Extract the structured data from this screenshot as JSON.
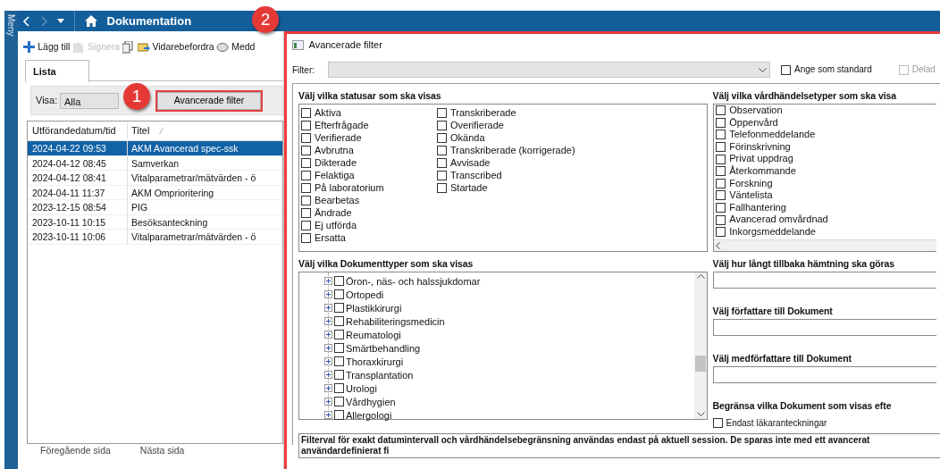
{
  "side_menu": {
    "label": "Meny"
  },
  "header": {
    "title": "Dokumentation"
  },
  "toolbar": [
    {
      "label": "Lägg till",
      "disabled": false
    },
    {
      "label": "Signera",
      "disabled": true
    },
    {
      "disabled": false
    },
    {
      "label": "Vidarebefordra",
      "disabled": false
    },
    {
      "label": "Medd",
      "disabled": false
    }
  ],
  "tabs": [
    {
      "label": "Lista",
      "selected": true
    }
  ],
  "view_filter": {
    "label": "Visa:",
    "value": "Alla",
    "button": "Avancerade filter"
  },
  "table": {
    "columns": [
      "Utförandedatum/tid",
      "Titel"
    ],
    "rows": [
      {
        "cells": [
          "2024-04-22 09:53",
          "AKM Avancerad spec-ssk"
        ],
        "selected": true
      },
      {
        "cells": [
          "2024-04-12 08:45",
          "Samverkan"
        ],
        "selected": false
      },
      {
        "cells": [
          "2024-04-12 08:41",
          "Vitalparametrar/mätvärden - ö"
        ],
        "selected": false
      },
      {
        "cells": [
          "2024-04-11 11:37",
          "AKM Omprioritering"
        ],
        "selected": false
      },
      {
        "cells": [
          "2023-12-15 08:54",
          "PIG"
        ],
        "selected": false
      },
      {
        "cells": [
          "2023-10-11 10:15",
          "Besöksanteckning"
        ],
        "selected": false
      },
      {
        "cells": [
          "2023-10-11 10:06",
          "Vitalparametrar/mätvärden - ö"
        ],
        "selected": false
      }
    ]
  },
  "pager": [
    "Föregående sida",
    "Nästa sida"
  ],
  "callouts": [
    "1",
    "2"
  ],
  "dialog": {
    "title": "Avancerade filter",
    "filter_label": "Filter:",
    "set_default": {
      "label": "Ange som standard",
      "checked": false,
      "disabled": false
    },
    "shared": {
      "label": "Delad",
      "checked": false,
      "disabled": true
    },
    "statuses": {
      "heading": "Välj vilka statusar som ska visas",
      "items": [
        {
          "label": "Aktiva",
          "checked": false
        },
        {
          "label": "Efterfrågade",
          "checked": false
        },
        {
          "label": "Verifierade",
          "checked": false
        },
        {
          "label": "Avbrutna",
          "checked": false
        },
        {
          "label": "Dikterade",
          "checked": false
        },
        {
          "label": "Felaktiga",
          "checked": false
        },
        {
          "label": "På laboratorium",
          "checked": false
        },
        {
          "label": "Bearbetas",
          "checked": false
        },
        {
          "label": "Ändrade",
          "checked": false
        },
        {
          "label": "Ej utförda",
          "checked": false
        },
        {
          "label": "Ersatta",
          "checked": false
        },
        {
          "label": "Transkriberade",
          "checked": false
        },
        {
          "label": "Overifierade",
          "checked": false
        },
        {
          "label": "Okända",
          "checked": false
        },
        {
          "label": "Transkriberade (korrigerade)",
          "checked": false
        },
        {
          "label": "Avvisade",
          "checked": false
        },
        {
          "label": "Transcribed",
          "checked": false
        },
        {
          "label": "Startade",
          "checked": false
        }
      ]
    },
    "care_event_types": {
      "heading": "Välj vilka vårdhändelsetyper som ska visa",
      "items": [
        {
          "label": "Observation",
          "checked": false
        },
        {
          "label": "Öppenvård",
          "checked": false
        },
        {
          "label": "Telefonmeddelande",
          "checked": false
        },
        {
          "label": "Förinskrivning",
          "checked": false
        },
        {
          "label": "Privat uppdrag",
          "checked": false
        },
        {
          "label": "Återkommande",
          "checked": false
        },
        {
          "label": "Forskning",
          "checked": false
        },
        {
          "label": "Väntelista",
          "checked": false
        },
        {
          "label": "Fallhantering",
          "checked": false
        },
        {
          "label": "Avancerad omvårdnad",
          "checked": false
        },
        {
          "label": "Inkorgsmeddelande",
          "checked": false
        }
      ]
    },
    "document_types": {
      "heading": "Välj vilka Dokumenttyper som ska visas",
      "items": [
        {
          "label": "Öron-, näs- och halssjukdomar",
          "checked": false,
          "expanded": false
        },
        {
          "label": "Ortopedi",
          "checked": false,
          "expanded": false
        },
        {
          "label": "Plastikkirurgi",
          "checked": false,
          "expanded": false
        },
        {
          "label": "Rehabiliteringsmedicin",
          "checked": false,
          "expanded": false
        },
        {
          "label": "Reumatologi",
          "checked": false,
          "expanded": false
        },
        {
          "label": "Smärtbehandling",
          "checked": false,
          "expanded": false
        },
        {
          "label": "Thoraxkirurgi",
          "checked": false,
          "expanded": false
        },
        {
          "label": "Transplantation",
          "checked": false,
          "expanded": false
        },
        {
          "label": "Urologi",
          "checked": false,
          "expanded": false
        },
        {
          "label": "Vårdhygien",
          "checked": false,
          "expanded": false
        },
        {
          "label": "Allergologi",
          "checked": false,
          "expanded": false
        }
      ]
    },
    "fetch_range": {
      "heading": "Välj hur långt tillbaka hämtning ska göras"
    },
    "author": {
      "heading": "Välj författare till Dokument"
    },
    "co_author": {
      "heading": "Välj medförfattare till Dokument"
    },
    "limit": {
      "heading": "Begränsa vilka Dokument som visas efte",
      "option": {
        "label": "Endast läkaranteckningar",
        "checked": false
      }
    },
    "message": "Filterval för exakt datumintervall och vårdhändelsebegränsning användas endast på aktuell session. De sparas inte med ett avancerat användardefinierat fi"
  }
}
